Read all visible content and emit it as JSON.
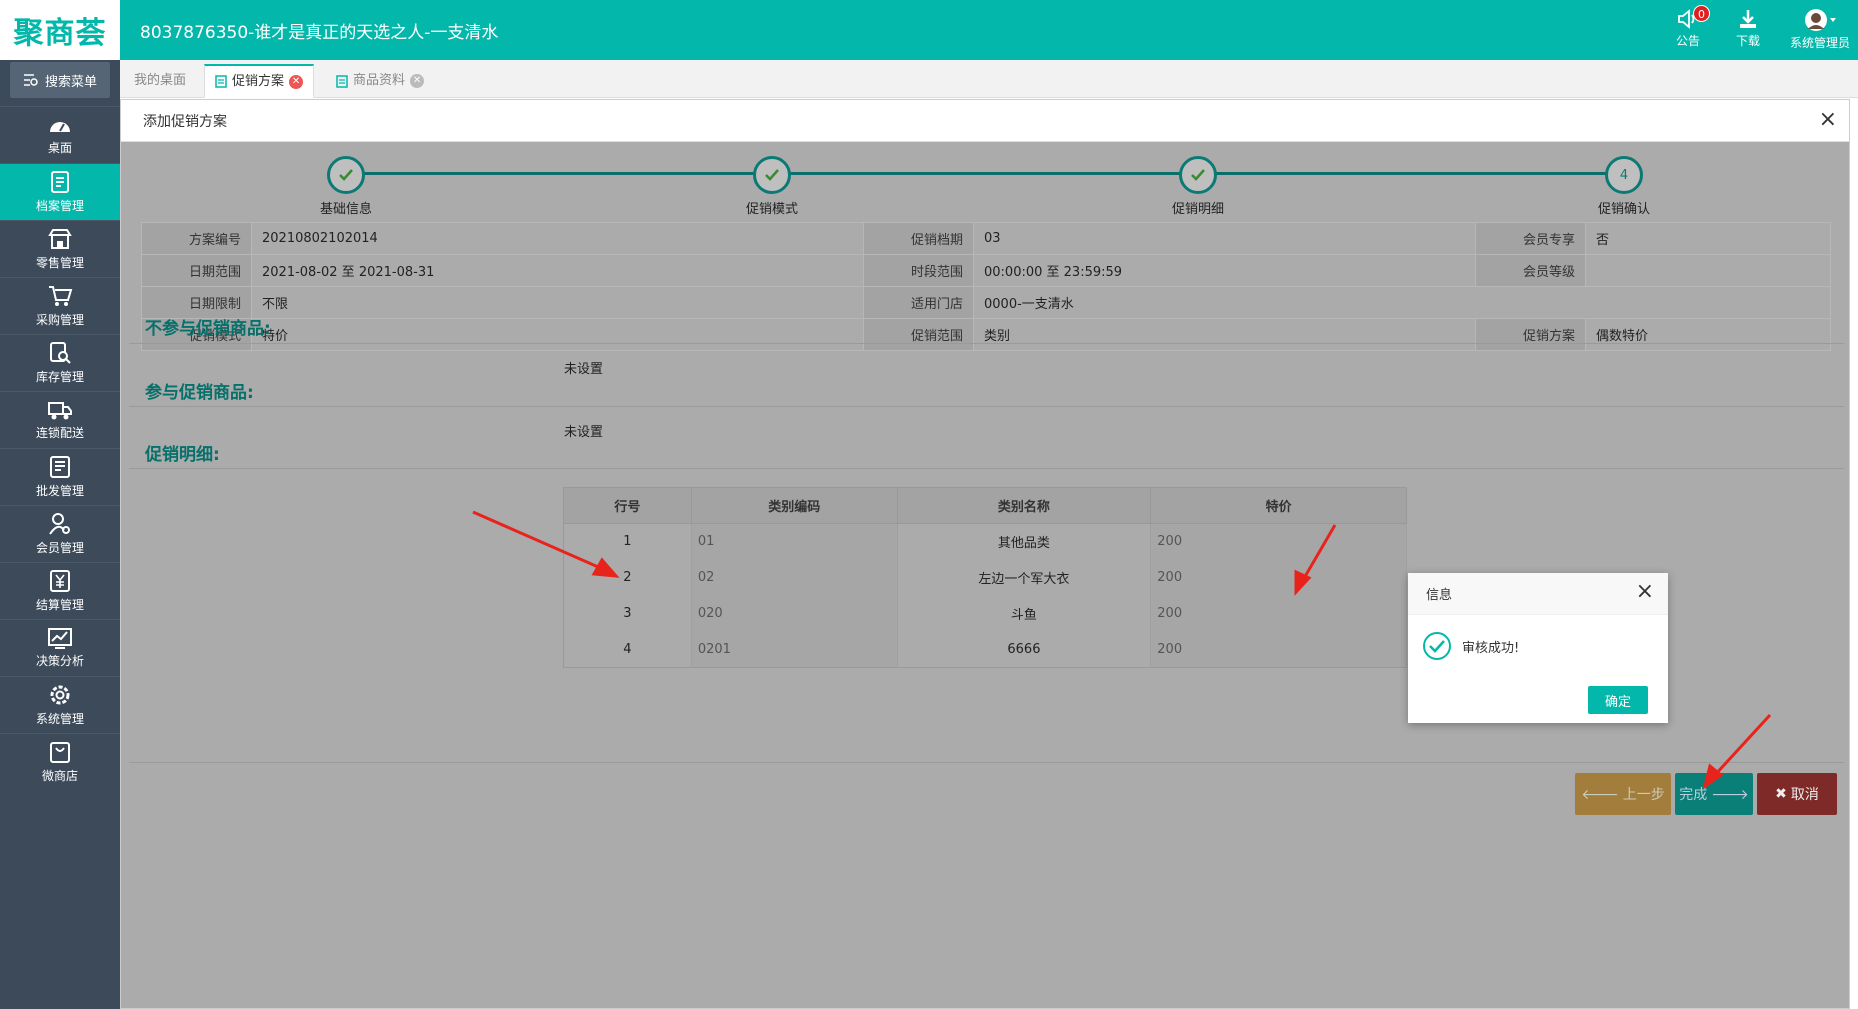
{
  "app": {
    "logo": "聚商荟",
    "title": "8037876350-谁才是真正的天选之人-一支清水"
  },
  "header_tools": [
    {
      "label": "公告",
      "icon": "speaker-icon",
      "badge": "0"
    },
    {
      "label": "下载",
      "icon": "download-icon"
    },
    {
      "label": "系统管理员",
      "icon": "avatar-icon"
    }
  ],
  "sidebar": {
    "search_label": "搜索菜单",
    "items": [
      {
        "label": "桌面",
        "icon": "dashboard-icon"
      },
      {
        "label": "档案管理",
        "icon": "archive-icon",
        "active": true
      },
      {
        "label": "零售管理",
        "icon": "store-icon"
      },
      {
        "label": "采购管理",
        "icon": "cart-icon"
      },
      {
        "label": "库存管理",
        "icon": "inventory-search-icon"
      },
      {
        "label": "连锁配送",
        "icon": "truck-icon"
      },
      {
        "label": "批发管理",
        "icon": "wholesale-icon"
      },
      {
        "label": "会员管理",
        "icon": "member-icon"
      },
      {
        "label": "结算管理",
        "icon": "yen-icon"
      },
      {
        "label": "决策分析",
        "icon": "chart-icon"
      },
      {
        "label": "系统管理",
        "icon": "gear-icon"
      },
      {
        "label": "微商店",
        "icon": "shop-bag-icon"
      }
    ]
  },
  "tabs": [
    {
      "label": "我的桌面"
    },
    {
      "label": "促销方案",
      "active": true
    },
    {
      "label": "商品资料"
    }
  ],
  "panel": {
    "title": "添加促销方案",
    "steps": [
      "基础信息",
      "促销模式",
      "促销明细",
      "促销确认"
    ],
    "current_step_number": "4",
    "info": {
      "plan_no_label": "方案编号",
      "plan_no": "20210802102014",
      "period_label": "促销档期",
      "period": "03",
      "member_only_label": "会员专享",
      "member_only": "否",
      "date_range_label": "日期范围",
      "date_range": "2021-08-02 至 2021-08-31",
      "time_range_label": "时段范围",
      "time_range": "00:00:00 至 23:59:59",
      "member_level_label": "会员等级",
      "member_level": "",
      "date_limit_label": "日期限制",
      "date_limit": "不限",
      "store_label": "适用门店",
      "store": "0000-一支清水",
      "mode_label": "促销模式",
      "mode": "特价",
      "scope_label": "促销范围",
      "scope": "类别",
      "scheme_label": "促销方案",
      "scheme": "偶数特价"
    },
    "excluded_title": "不参与促销商品:",
    "excluded_value": "未设置",
    "included_title": "参与促销商品:",
    "included_value": "未设置",
    "detail_title": "促销明细:",
    "detail_columns": [
      "行号",
      "类别编码",
      "类别名称",
      "特价"
    ],
    "detail_rows": [
      {
        "no": "1",
        "code": "01",
        "name": "其他品类",
        "price": "200"
      },
      {
        "no": "2",
        "code": "02",
        "name": "左边一个军大衣",
        "price": "200"
      },
      {
        "no": "3",
        "code": "020",
        "name": "斗鱼",
        "price": "200"
      },
      {
        "no": "4",
        "code": "0201",
        "name": "6666",
        "price": "200"
      }
    ],
    "buttons": {
      "prev": "上一步",
      "finish": "完成",
      "cancel": "取消"
    }
  },
  "modal": {
    "title": "信息",
    "message": "审核成功!",
    "ok": "确定"
  },
  "colors": {
    "brand": "#03b8aa",
    "sidebar": "#3c4a5a",
    "step": "#0b7a74",
    "arrow": "#e8231b"
  }
}
